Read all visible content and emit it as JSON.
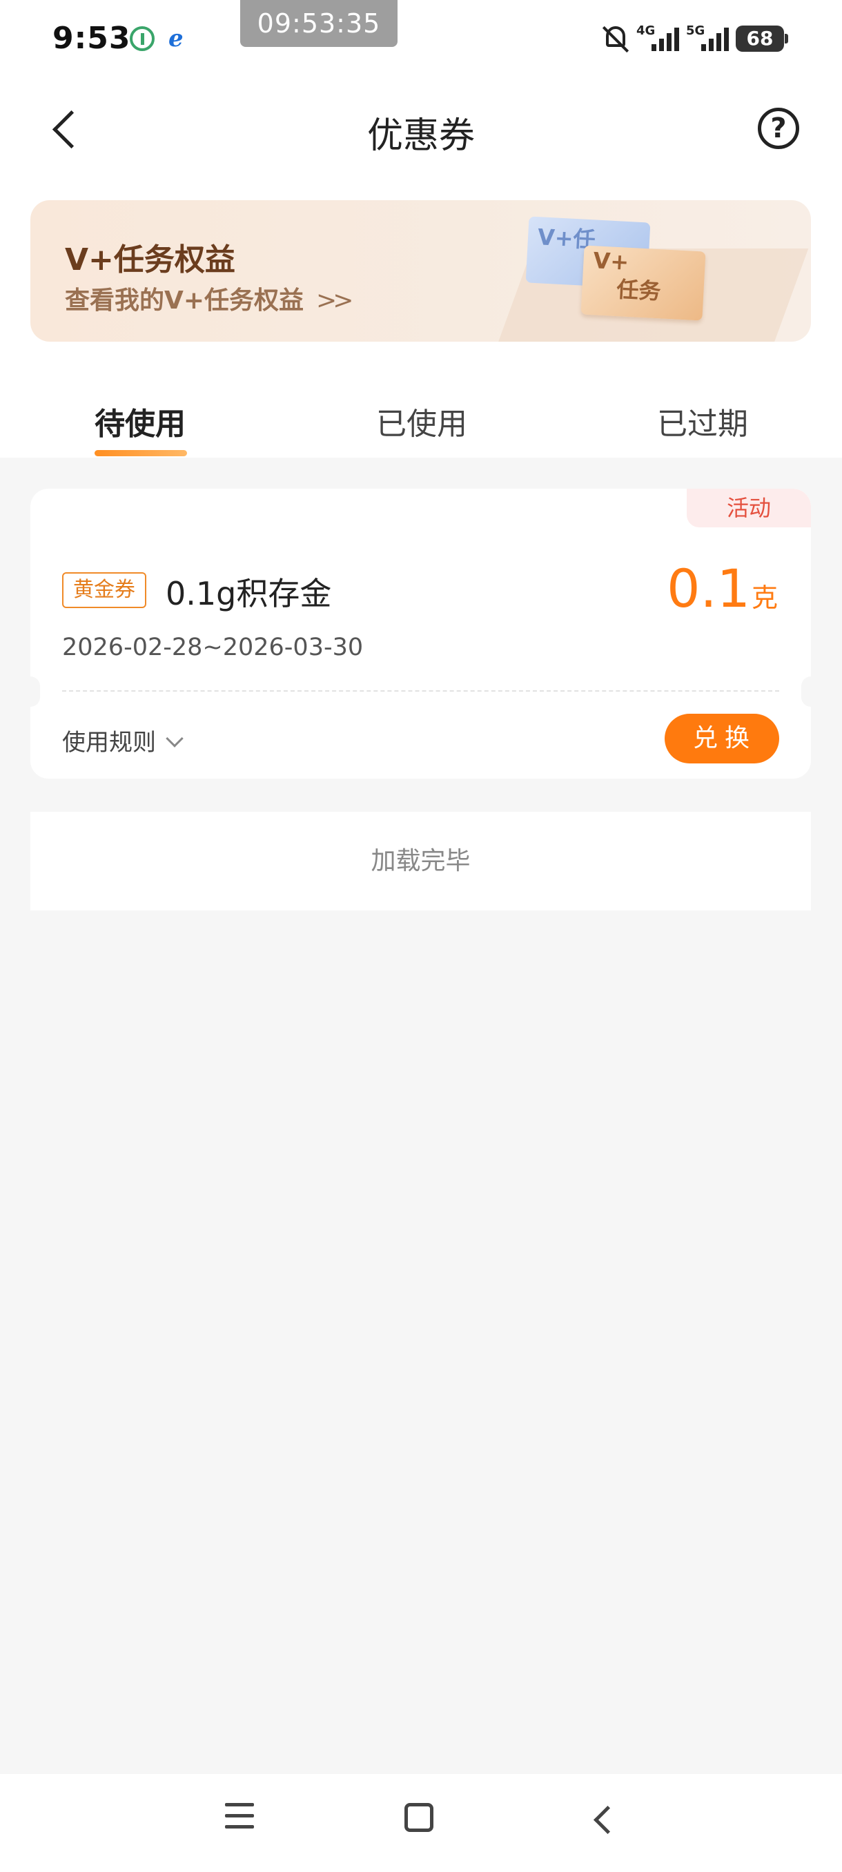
{
  "status_bar": {
    "time": "9:53",
    "overlay_clock": "09:53:35",
    "network_1": "4G",
    "network_2": "5G",
    "battery": "68"
  },
  "header": {
    "title": "优惠券",
    "back_icon": "back-arrow-icon",
    "help_icon": "question-circle-icon",
    "help_symbol": "?"
  },
  "banner": {
    "title": "V+任务权益",
    "subtitle": "查看我的V+任务权益",
    "arrow": ">>",
    "card_label": "V+",
    "card_label_2": "任务",
    "blue_card_text": "V+任"
  },
  "tabs": [
    {
      "label": "待使用",
      "active": true
    },
    {
      "label": "已使用",
      "active": false
    },
    {
      "label": "已过期",
      "active": false
    }
  ],
  "coupon": {
    "tag": "活动",
    "badge": "黄金券",
    "name": "0.1g积存金",
    "amount": "0.1",
    "unit": "克",
    "date_range": "2026-02-28~2026-03-30",
    "rules_label": "使用规则",
    "redeem_label": "兑换"
  },
  "list_end_text": "加载完毕",
  "colors": {
    "accent": "#ff7a0e",
    "tag_bg": "#fdecec",
    "tag_text": "#e4503e",
    "background": "#f6f6f6"
  },
  "nav_bar": {
    "icons": [
      "menu-icon",
      "home-icon",
      "back-icon"
    ]
  }
}
